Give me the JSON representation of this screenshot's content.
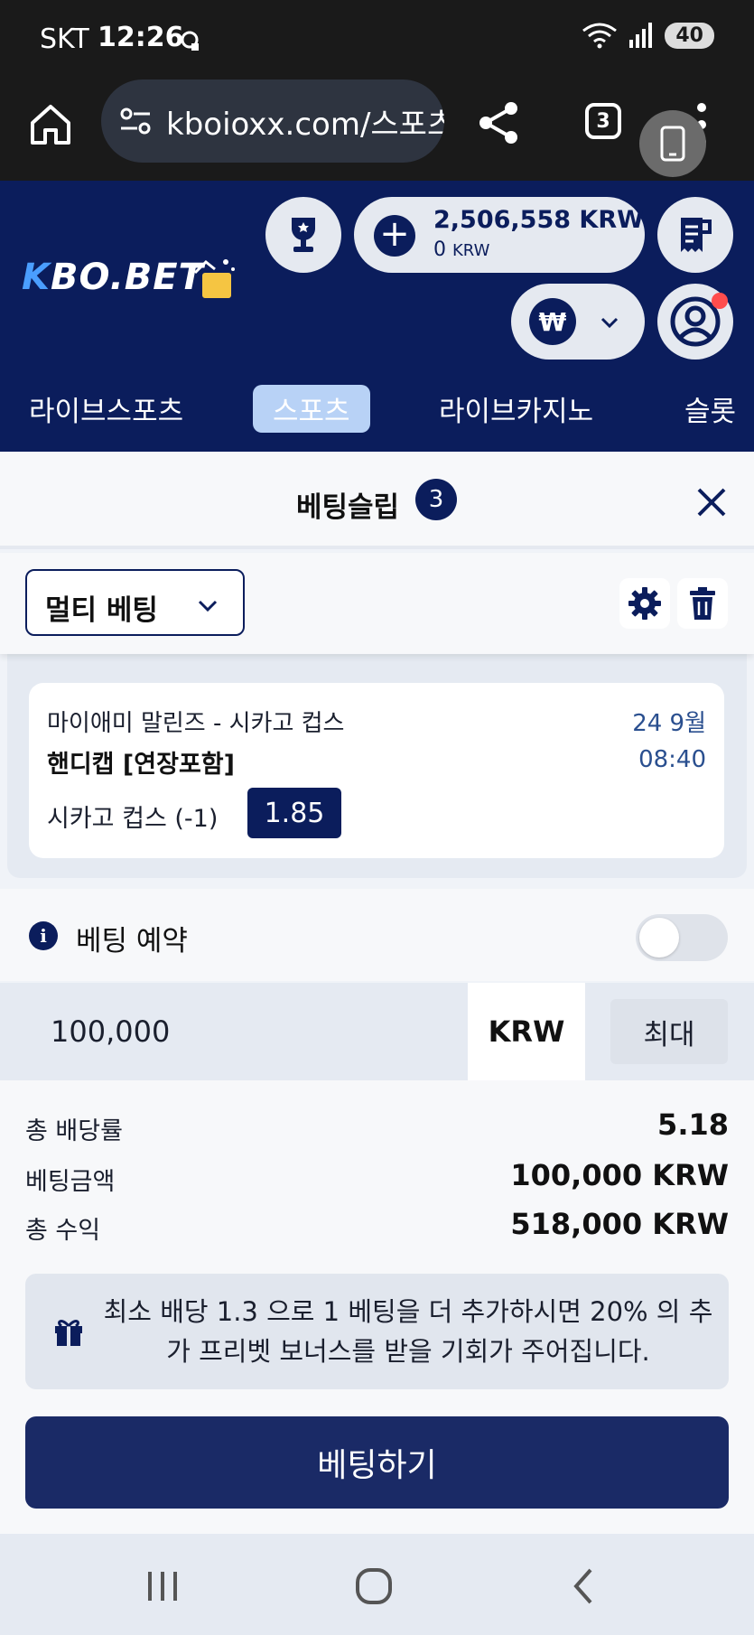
{
  "status_bar": {
    "carrier": "SKT",
    "time": "12:26",
    "battery": "40"
  },
  "browser": {
    "url": "kboioxx.com/스포츠",
    "tab_count": "3"
  },
  "site": {
    "logo_text": "KBO.BET",
    "balance": "2,506,558 KRW",
    "bonus_balance_value": "0",
    "bonus_balance_unit": "KRW",
    "currency_symbol": "₩"
  },
  "nav": {
    "items": [
      "라이브스포츠",
      "스포츠",
      "라이브카지노",
      "슬롯"
    ],
    "active_index": 1
  },
  "betslip": {
    "title": "베팅슬립",
    "count": "3",
    "bet_type": "멀티 베팅",
    "card": {
      "match": "마이애미 말린즈 - 시카고 컵스",
      "market": "핸디캡 [연장포함]",
      "date": "24 9월",
      "time": "08:40",
      "selection": "시카고 컵스 (-1)",
      "odds": "1.85"
    },
    "reserve_label": "베팅 예약",
    "reserve_enabled": false,
    "stake_value": "100,000",
    "stake_currency": "KRW",
    "max_label": "최대",
    "summary": {
      "total_odds_label": "총 배당률",
      "total_odds_value": "5.18",
      "stake_label": "베팅금액",
      "stake_value": "100,000 KRW",
      "payout_label": "총 수익",
      "payout_value": "518,000 KRW"
    },
    "bonus_message": "최소 배당 1.3 으로 1 베팅을 더 추가하시면 20% 의 추가 프리벳 보너스를 받을 기회가 주어집니다.",
    "place_bet_label": "베팅하기"
  },
  "colors": {
    "brand": "#0b1d5c",
    "accent_light": "#b8d2f6",
    "alert_dot": "#ff4d4d"
  }
}
